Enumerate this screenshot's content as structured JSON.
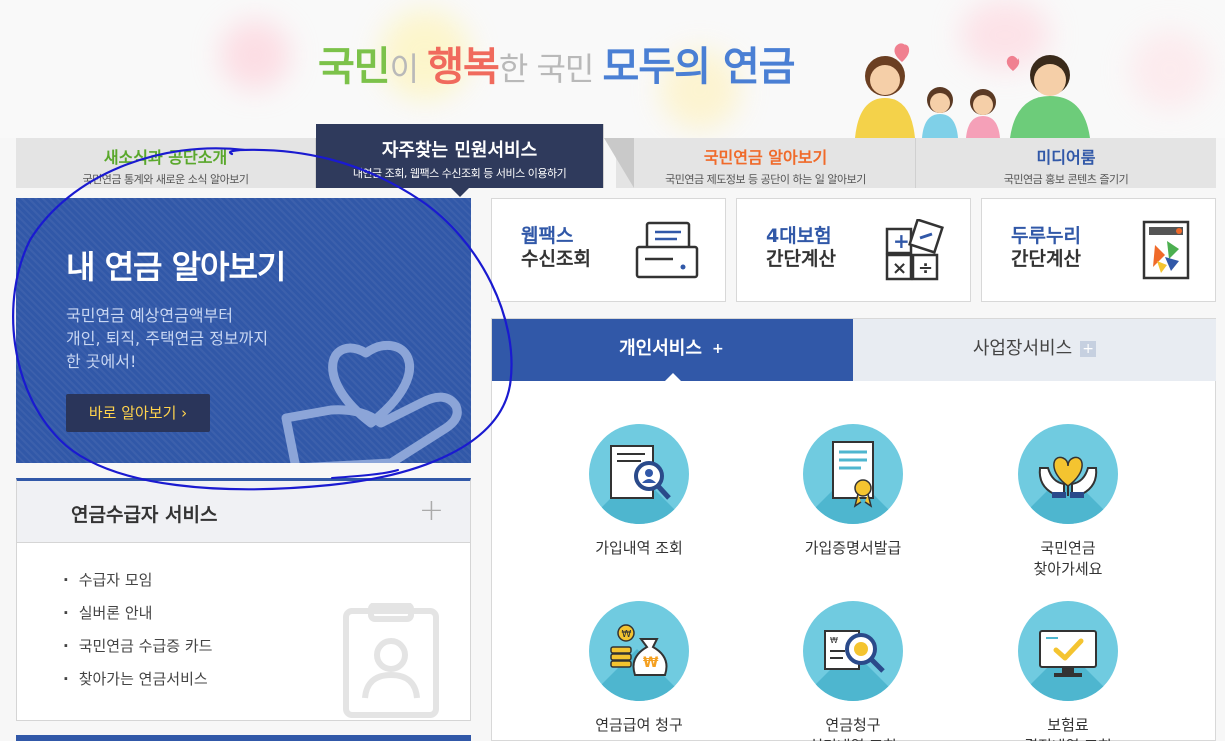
{
  "banner": {
    "slogan_part1": "국민",
    "slogan_part2": "이 ",
    "slogan_part3": "행복",
    "slogan_part4": "한 국민 ",
    "slogan_part5": "모두의 연금"
  },
  "tabs": [
    {
      "title": "새소식과 공단소개",
      "sub": "국민연금 통계와 새로운 소식 알아보기",
      "color": "#5aa82c"
    },
    {
      "title": "자주찾는 민원서비스",
      "sub": "내연금 조회, 웹팩스 수신조회 등 서비스 이용하기",
      "color": "#ffffff"
    },
    {
      "title": "국민연금 알아보기",
      "sub": "국민연금 제도정보 등 공단이 하는 일 알아보기",
      "color": "#f06a2a"
    },
    {
      "title": "미디어룸",
      "sub": "국민연금 홍보 콘텐츠 즐기기",
      "color": "#3158a8"
    }
  ],
  "promo": {
    "title": "내 연금 알아보기",
    "desc1": "국민연금 예상연금액부터",
    "desc2": "개인, 퇴직, 주택연금 정보까지",
    "desc3": "한 곳에서!",
    "button": "바로 알아보기 ›"
  },
  "recipient": {
    "title": "연금수급자 서비스",
    "plus": "+",
    "items": [
      "수급자 모임",
      "실버론 안내",
      "국민연금 수급증 카드",
      "찾아가는 연금서비스"
    ]
  },
  "quick": [
    {
      "line1": "웹팩스",
      "line2": "수신조회",
      "icon": "fax-icon"
    },
    {
      "line1": "4대보험",
      "line2": "간단계산",
      "icon": "calculator-icon"
    },
    {
      "line1": "두루누리",
      "line2": "간단계산",
      "icon": "durunuri-icon"
    }
  ],
  "service_tabs": {
    "personal": "개인서비스",
    "business": "사업장서비스",
    "plus": "+"
  },
  "services": [
    {
      "label": "가입내역 조회",
      "icon": "document-search-icon"
    },
    {
      "label": "가입증명서발급",
      "icon": "certificate-icon"
    },
    {
      "label": "국민연금\n찾아가세요",
      "icon": "heart-hands-icon"
    },
    {
      "label": "연금급여 청구",
      "icon": "money-bag-icon"
    },
    {
      "label": "연금청구\n처리내역 조회",
      "icon": "receipt-search-icon"
    },
    {
      "label": "보험료\n결정내역 조회",
      "icon": "monitor-check-icon"
    }
  ],
  "colors": {
    "accent": "#3158a8",
    "navy": "#2f3a5c",
    "annotation": "#1a1ad0"
  }
}
